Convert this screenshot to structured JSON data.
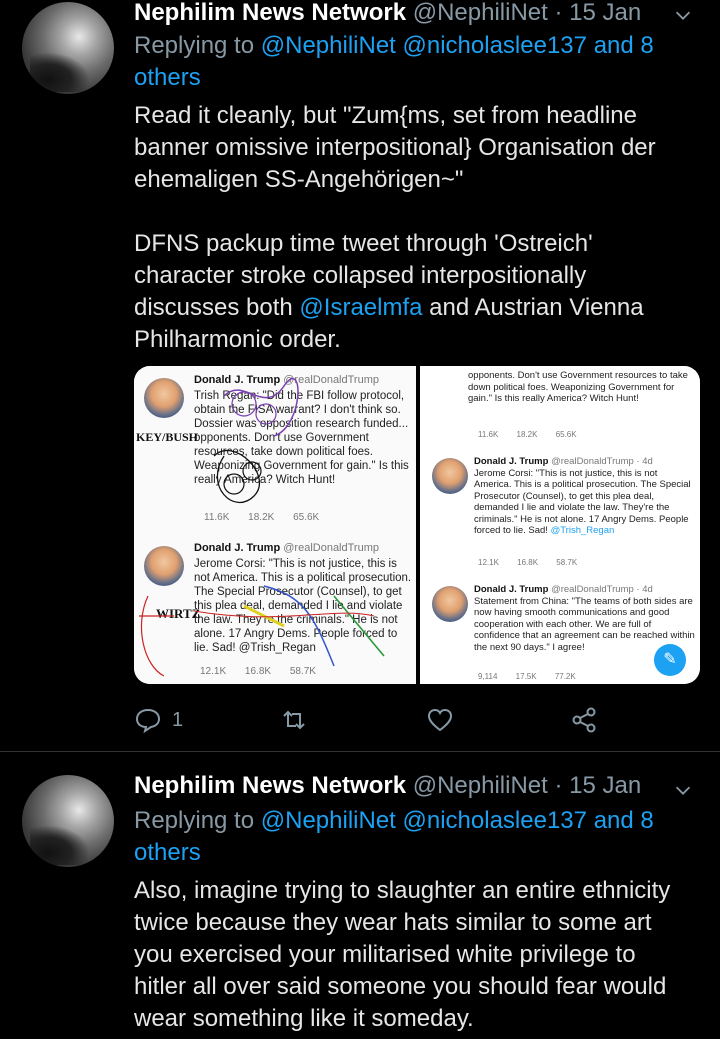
{
  "tweet1": {
    "name": "Nephilim News Network",
    "handle": "@NephiliNet",
    "separator": "·",
    "date": "15 Jan",
    "replying_prefix": "Replying to ",
    "replying_to_1": "@NephiliNet",
    "replying_to_2": "@nicholaslee137",
    "replying_others": "and 8 others",
    "para1": "Read it cleanly, but \"Zum{ms, set from headline banner omissive interpositional} Organisation der ehemaligen SS-Angehörigen~\"",
    "para2_pre": "DFNS packup time tweet through 'Ostreich' character stroke collapsed interpositionally discusses both ",
    "para2_link": "@Israelmfa",
    "para2_post": " and Austrian Vienna Philharmonic order.",
    "reply_count": "1"
  },
  "media": {
    "left_top": {
      "name": "Donald J. Trump",
      "handle": "@realDonaldTrump",
      "text": "Trish Regan: \"Did the FBI follow protocol, obtain the FISA warrant? I don't think so. Dossier was opposition research funded... opponents. Don't use Government resources, take down political foes. Weaponizing Government for gain.\" Is this really America? Witch Hunt!",
      "replies": "11.6K",
      "retweets": "18.2K",
      "likes": "65.6K"
    },
    "left_bottom": {
      "name": "Donald J. Trump",
      "handle": "@realDonaldTrump",
      "text": "Jerome Corsi: \"This is not justice, this is not America. This is a political prosecution. The Special Prosecutor (Counsel), to get this plea deal, demanded I lie and violate the law. They're the criminals.\" He is not alone. 17 Angry Dems. People forced to lie. Sad! @Trish_Regan",
      "replies": "12.1K",
      "retweets": "16.8K",
      "likes": "58.7K"
    },
    "annotation_1": "KEY/BUSH",
    "annotation_2": "WIRTZ",
    "right_top": {
      "text": "opponents. Don't use Government resources to take down political foes. Weaponizing Government for gain.\" Is this really America? Witch Hunt!",
      "replies": "11.6K",
      "retweets": "18.2K",
      "likes": "65.6K"
    },
    "right_mid": {
      "name": "Donald J. Trump",
      "handle": "@realDonaldTrump · 4d",
      "text": "Jerome Corsi: \"This is not justice, this is not America. This is a political prosecution. The Special Prosecutor (Counsel), to get this plea deal, demanded I lie and violate the law. They're the criminals.\" He is not alone. 17 Angry Dems. People forced to lie. Sad!",
      "link": "@Trish_Regan",
      "replies": "12.1K",
      "retweets": "16.8K",
      "likes": "58.7K"
    },
    "right_bottom": {
      "name": "Donald J. Trump",
      "handle": "@realDonaldTrump · 4d",
      "text": "Statement from China: \"The teams of both sides are now having smooth communications and good cooperation with each other. We are full of confidence that an agreement can be reached within the next 90 days.\" I agree!",
      "replies": "9,114",
      "retweets": "17.5K",
      "likes": "77.2K"
    }
  },
  "tweet2": {
    "name": "Nephilim News Network",
    "handle": "@NephiliNet",
    "separator": "·",
    "date": "15 Jan",
    "replying_prefix": "Replying to ",
    "replying_to_1": "@NephiliNet",
    "replying_to_2": "@nicholaslee137",
    "replying_others": "and 8 others",
    "body": "Also, imagine trying to slaughter an entire ethnicity twice because they wear hats similar to some art you exercised your militarised white privilege to hitler all over said someone you should fear would wear something like it someday."
  },
  "colors": {
    "background": "#000000",
    "name": "#ffffff",
    "muted": "#8899a6",
    "link": "#1da1f2",
    "divider": "#2f3336"
  },
  "icons": [
    "chevron-down-icon",
    "reply-icon",
    "retweet-icon",
    "like-icon",
    "share-icon",
    "verified-icon",
    "compose-icon"
  ]
}
